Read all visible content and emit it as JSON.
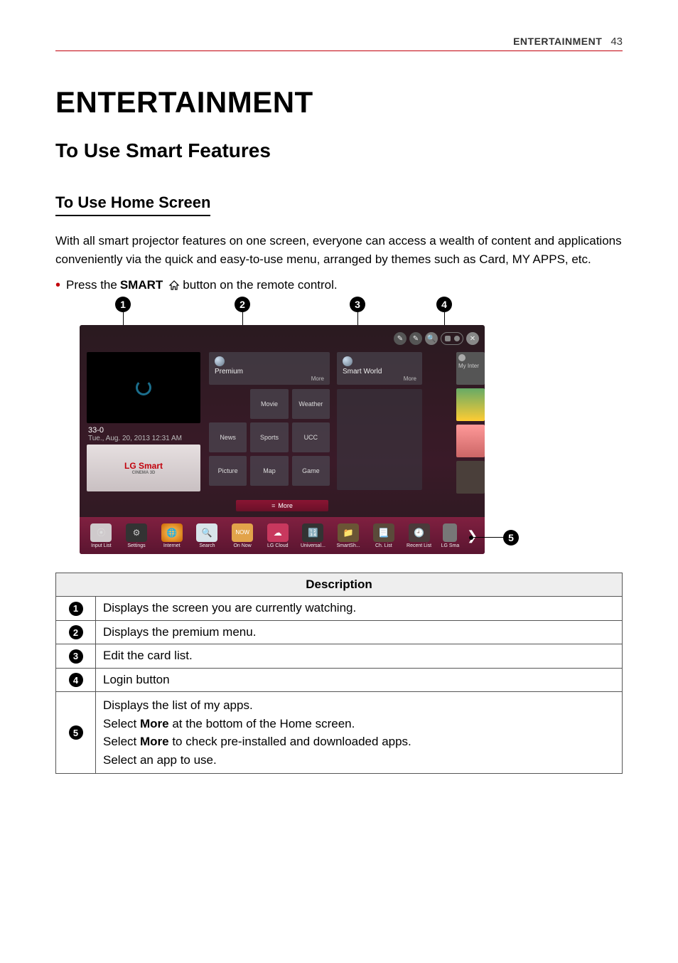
{
  "header": {
    "section": "ENTERTAINMENT",
    "page": "43"
  },
  "title": "ENTERTAINMENT",
  "subtitle": "To Use Smart Features",
  "section_title": "To Use Home Screen",
  "intro": "With all smart projector features on one screen, everyone can access a wealth of content and applications conveniently via the quick and easy-to-use menu, arranged by themes such as Card, MY APPS, etc.",
  "bullet": {
    "pre": "Press the ",
    "strong": "SMART",
    "post": " button on the remote control."
  },
  "screenshot": {
    "channel": "33-0",
    "datetime": "Tue., Aug. 20, 2013  12:31 AM",
    "banner_logo": "LG Smart",
    "banner_sub": "CINEMA 3D",
    "col2": {
      "head": "Premium",
      "more": "More",
      "cells": [
        "Movie",
        "Weather",
        "News",
        "Sports",
        "UCC",
        "Picture",
        "Map",
        "Game"
      ]
    },
    "col3": {
      "head": "Smart World",
      "more": "More"
    },
    "thumb_right_label": "My Inter",
    "more_bar": "More",
    "dock": [
      "Input List",
      "Settings",
      "Internet",
      "Search",
      "On Now",
      "LG Cloud",
      "Universal...",
      "SmartSh...",
      "Ch. List",
      "Recent List"
    ],
    "dock_last": "LG Sma"
  },
  "table": {
    "header": "Description",
    "rows": {
      "r1": "Displays the screen you are currently watching.",
      "r2": "Displays the premium menu.",
      "r3": "Edit the card list.",
      "r4": "Login button",
      "r5": {
        "l1": "Displays the list of my apps.",
        "l2_pre": "Select ",
        "l2_b": "More",
        "l2_post": " at the bottom of the Home screen.",
        "l3_pre": "Select ",
        "l3_b": "More",
        "l3_post": " to check pre-installed and downloaded apps.",
        "l4": "Select an app to use."
      }
    }
  }
}
